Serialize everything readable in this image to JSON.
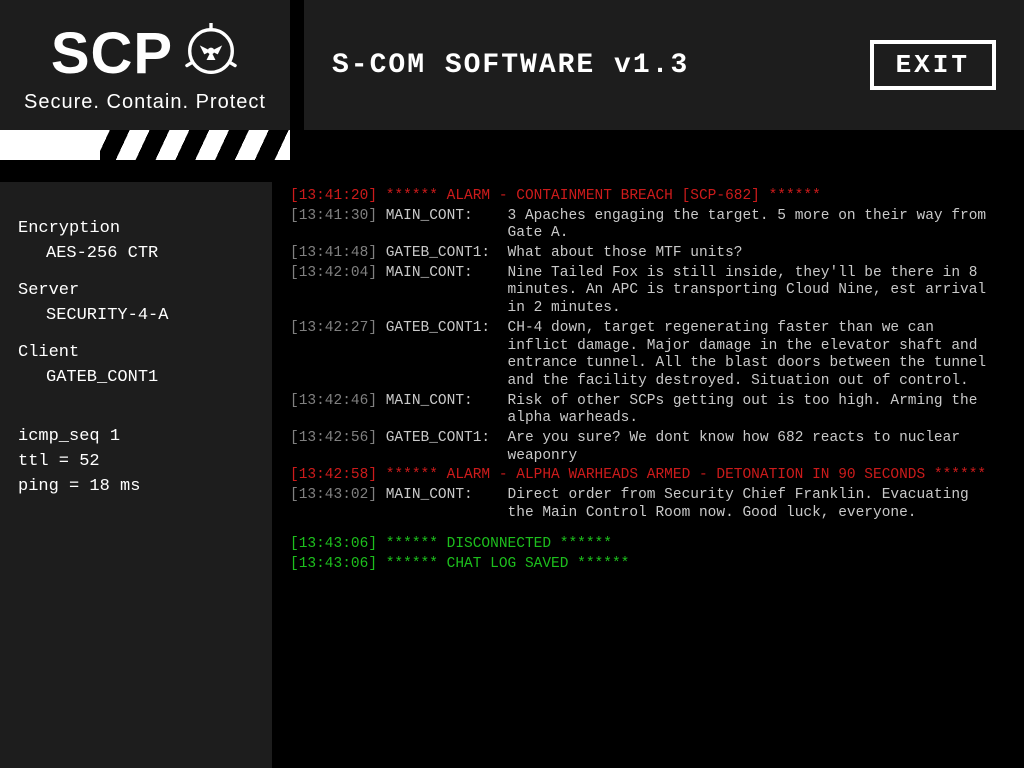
{
  "logo": {
    "acronym": "SCP",
    "tagline": "Secure. Contain. Protect"
  },
  "header": {
    "title": "S-COM SOFTWARE v1.3",
    "exit_label": "EXIT"
  },
  "sidebar": {
    "encryption_label": "Encryption",
    "encryption_value": "AES-256 CTR",
    "server_label": "Server",
    "server_value": "SECURITY-4-A",
    "client_label": "Client",
    "client_value": "GATEB_CONT1",
    "icmp": "icmp_seq 1",
    "ttl": "ttl = 52",
    "ping": "ping = 18 ms"
  },
  "log": [
    {
      "ts": "[13:41:20]",
      "type": "red",
      "who": "",
      "msg": "****** ALARM - CONTAINMENT BREACH [SCP-682] ******"
    },
    {
      "ts": "[13:41:30]",
      "type": "gray",
      "who": "MAIN_CONT:",
      "msg": "3 Apaches engaging the target. 5 more on their way from Gate A."
    },
    {
      "ts": "[13:41:48]",
      "type": "gray",
      "who": "GATEB_CONT1:",
      "msg": "What about those MTF units?"
    },
    {
      "ts": "[13:42:04]",
      "type": "gray",
      "who": "MAIN_CONT:",
      "msg": "Nine Tailed Fox is still inside, they'll be there in 8 minutes. An APC is transporting Cloud Nine, est arrival in 2 minutes."
    },
    {
      "ts": "[13:42:27]",
      "type": "gray",
      "who": "GATEB_CONT1:",
      "msg": "CH-4 down, target regenerating faster than we can inflict damage. Major damage in the elevator shaft and entrance tunnel. All the blast doors between the tunnel and the facility destroyed. Situation out of control."
    },
    {
      "ts": "[13:42:46]",
      "type": "gray",
      "who": "MAIN_CONT:",
      "msg": "Risk of other SCPs getting out is too high. Arming the alpha warheads."
    },
    {
      "ts": "[13:42:56]",
      "type": "gray",
      "who": "GATEB_CONT1:",
      "msg": "Are you sure? We dont know how 682 reacts to nuclear weaponry"
    },
    {
      "ts": "[13:42:58]",
      "type": "red",
      "who": "",
      "msg": "****** ALARM - ALPHA WARHEADS ARMED - DETONATION IN 90 SECONDS ******"
    },
    {
      "ts": "[13:43:02]",
      "type": "gray",
      "who": "MAIN_CONT:",
      "msg": "Direct order from Security Chief Franklin. Evacuating the Main Control Room now. Good luck, everyone."
    },
    {
      "spacer": true
    },
    {
      "ts": "[13:43:06]",
      "type": "green",
      "who": "",
      "msg": "****** DISCONNECTED ******"
    },
    {
      "ts": "[13:43:06]",
      "type": "green",
      "who": "",
      "msg": "****** CHAT LOG SAVED ******"
    }
  ],
  "layout": {
    "who_col_width": 13
  }
}
